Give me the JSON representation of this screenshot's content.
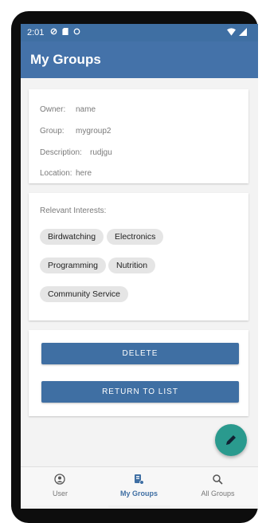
{
  "status": {
    "time": "2:01"
  },
  "appbar": {
    "title": "My Groups"
  },
  "details": [
    {
      "label": "Owner:",
      "value": "name"
    },
    {
      "label": "Group:",
      "value": "mygroup2"
    },
    {
      "label": "Description:",
      "value": "rudjgu"
    },
    {
      "label": "Location:",
      "value": "here"
    }
  ],
  "interests": {
    "heading": "Relevant Interests:",
    "chips": [
      "Birdwatching",
      "Electronics",
      "Programming",
      "Nutrition",
      "Community Service"
    ]
  },
  "actions": {
    "delete": "DELETE",
    "return": "RETURN TO LIST"
  },
  "bottomnav": {
    "items": [
      {
        "label": "User",
        "icon": "user-icon",
        "active": false
      },
      {
        "label": "My Groups",
        "icon": "groups-icon",
        "active": true
      },
      {
        "label": "All Groups",
        "icon": "search-icon",
        "active": false
      }
    ]
  },
  "colors": {
    "primary": "#4472a9",
    "button": "#3f6fa3",
    "fab": "#2a9a8e",
    "chip": "#e5e5e5"
  }
}
